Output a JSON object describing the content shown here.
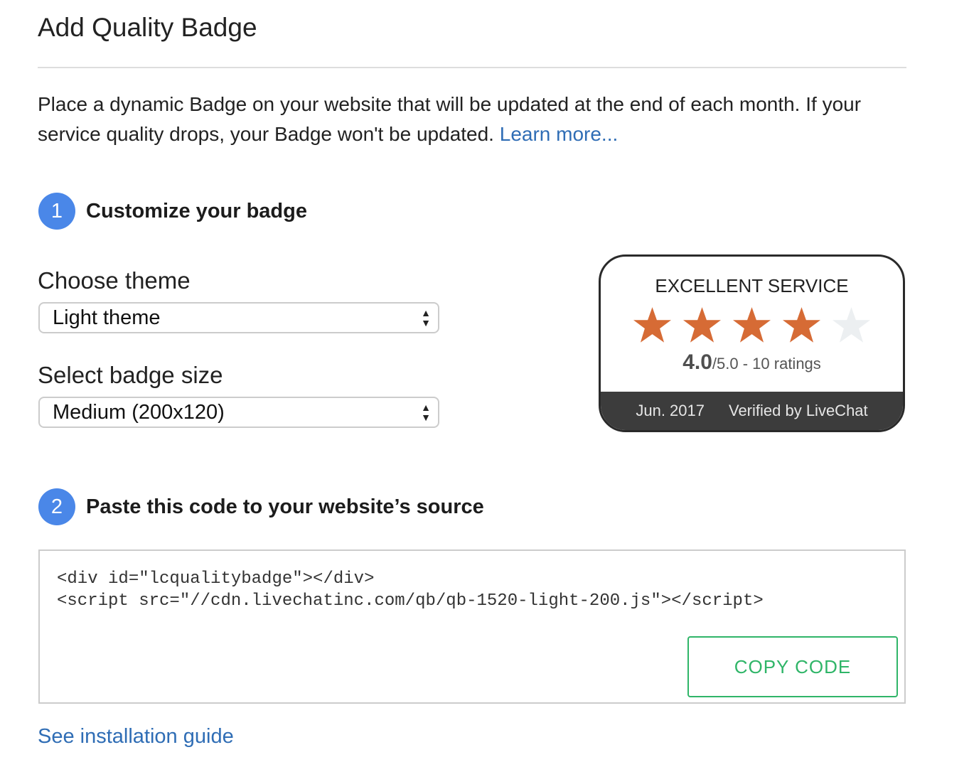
{
  "page": {
    "title": "Add Quality Badge"
  },
  "intro": {
    "text": "Place a dynamic Badge on your website that will be updated at the end of each month. If your service quality drops, your Badge won't be updated. ",
    "learn_more": "Learn more..."
  },
  "step1": {
    "number": "1",
    "title": "Customize your badge",
    "theme_label": "Choose theme",
    "theme_value": "Light theme",
    "size_label": "Select badge size",
    "size_value": "Medium (200x120)"
  },
  "badge": {
    "heading": "EXCELLENT SERVICE",
    "rating_fraction": 0.8,
    "stars_filled": 4,
    "stars_total": 5,
    "score": "4.0",
    "score_suffix": "/5.0 - 10 ratings",
    "date": "Jun. 2017",
    "verified": "Verified by LiveChat",
    "star_color": "#d66b35",
    "star_empty_color": "#eceff1"
  },
  "step2": {
    "number": "2",
    "title": "Paste this code to your website’s source",
    "code_line1": "<div id=\"lcqualitybadge\"></div>",
    "code_line2": "<script src=\"//cdn.livechatinc.com/qb/qb-1520-light-200.js\"></script>",
    "copy_label": "COPY CODE"
  },
  "guide_link": "See installation guide",
  "colors": {
    "accent": "#4a87e8",
    "link": "#2f6db5",
    "copy_green": "#2fb568"
  }
}
